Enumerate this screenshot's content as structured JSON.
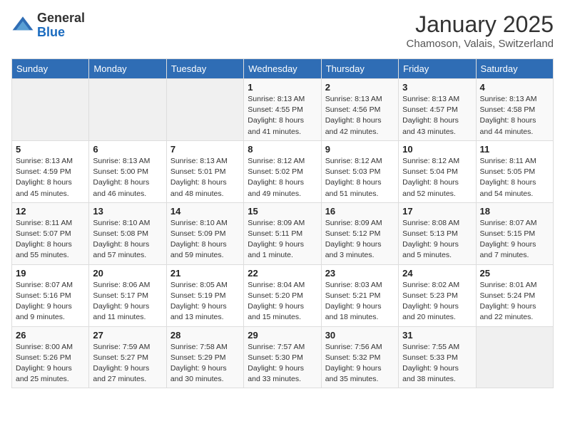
{
  "logo": {
    "general": "General",
    "blue": "Blue"
  },
  "calendar": {
    "title": "January 2025",
    "subtitle": "Chamoson, Valais, Switzerland"
  },
  "headers": [
    "Sunday",
    "Monday",
    "Tuesday",
    "Wednesday",
    "Thursday",
    "Friday",
    "Saturday"
  ],
  "weeks": [
    [
      {
        "day": "",
        "sunrise": "",
        "sunset": "",
        "daylight": ""
      },
      {
        "day": "",
        "sunrise": "",
        "sunset": "",
        "daylight": ""
      },
      {
        "day": "",
        "sunrise": "",
        "sunset": "",
        "daylight": ""
      },
      {
        "day": "1",
        "sunrise": "Sunrise: 8:13 AM",
        "sunset": "Sunset: 4:55 PM",
        "daylight": "Daylight: 8 hours and 41 minutes."
      },
      {
        "day": "2",
        "sunrise": "Sunrise: 8:13 AM",
        "sunset": "Sunset: 4:56 PM",
        "daylight": "Daylight: 8 hours and 42 minutes."
      },
      {
        "day": "3",
        "sunrise": "Sunrise: 8:13 AM",
        "sunset": "Sunset: 4:57 PM",
        "daylight": "Daylight: 8 hours and 43 minutes."
      },
      {
        "day": "4",
        "sunrise": "Sunrise: 8:13 AM",
        "sunset": "Sunset: 4:58 PM",
        "daylight": "Daylight: 8 hours and 44 minutes."
      }
    ],
    [
      {
        "day": "5",
        "sunrise": "Sunrise: 8:13 AM",
        "sunset": "Sunset: 4:59 PM",
        "daylight": "Daylight: 8 hours and 45 minutes."
      },
      {
        "day": "6",
        "sunrise": "Sunrise: 8:13 AM",
        "sunset": "Sunset: 5:00 PM",
        "daylight": "Daylight: 8 hours and 46 minutes."
      },
      {
        "day": "7",
        "sunrise": "Sunrise: 8:13 AM",
        "sunset": "Sunset: 5:01 PM",
        "daylight": "Daylight: 8 hours and 48 minutes."
      },
      {
        "day": "8",
        "sunrise": "Sunrise: 8:12 AM",
        "sunset": "Sunset: 5:02 PM",
        "daylight": "Daylight: 8 hours and 49 minutes."
      },
      {
        "day": "9",
        "sunrise": "Sunrise: 8:12 AM",
        "sunset": "Sunset: 5:03 PM",
        "daylight": "Daylight: 8 hours and 51 minutes."
      },
      {
        "day": "10",
        "sunrise": "Sunrise: 8:12 AM",
        "sunset": "Sunset: 5:04 PM",
        "daylight": "Daylight: 8 hours and 52 minutes."
      },
      {
        "day": "11",
        "sunrise": "Sunrise: 8:11 AM",
        "sunset": "Sunset: 5:05 PM",
        "daylight": "Daylight: 8 hours and 54 minutes."
      }
    ],
    [
      {
        "day": "12",
        "sunrise": "Sunrise: 8:11 AM",
        "sunset": "Sunset: 5:07 PM",
        "daylight": "Daylight: 8 hours and 55 minutes."
      },
      {
        "day": "13",
        "sunrise": "Sunrise: 8:10 AM",
        "sunset": "Sunset: 5:08 PM",
        "daylight": "Daylight: 8 hours and 57 minutes."
      },
      {
        "day": "14",
        "sunrise": "Sunrise: 8:10 AM",
        "sunset": "Sunset: 5:09 PM",
        "daylight": "Daylight: 8 hours and 59 minutes."
      },
      {
        "day": "15",
        "sunrise": "Sunrise: 8:09 AM",
        "sunset": "Sunset: 5:11 PM",
        "daylight": "Daylight: 9 hours and 1 minute."
      },
      {
        "day": "16",
        "sunrise": "Sunrise: 8:09 AM",
        "sunset": "Sunset: 5:12 PM",
        "daylight": "Daylight: 9 hours and 3 minutes."
      },
      {
        "day": "17",
        "sunrise": "Sunrise: 8:08 AM",
        "sunset": "Sunset: 5:13 PM",
        "daylight": "Daylight: 9 hours and 5 minutes."
      },
      {
        "day": "18",
        "sunrise": "Sunrise: 8:07 AM",
        "sunset": "Sunset: 5:15 PM",
        "daylight": "Daylight: 9 hours and 7 minutes."
      }
    ],
    [
      {
        "day": "19",
        "sunrise": "Sunrise: 8:07 AM",
        "sunset": "Sunset: 5:16 PM",
        "daylight": "Daylight: 9 hours and 9 minutes."
      },
      {
        "day": "20",
        "sunrise": "Sunrise: 8:06 AM",
        "sunset": "Sunset: 5:17 PM",
        "daylight": "Daylight: 9 hours and 11 minutes."
      },
      {
        "day": "21",
        "sunrise": "Sunrise: 8:05 AM",
        "sunset": "Sunset: 5:19 PM",
        "daylight": "Daylight: 9 hours and 13 minutes."
      },
      {
        "day": "22",
        "sunrise": "Sunrise: 8:04 AM",
        "sunset": "Sunset: 5:20 PM",
        "daylight": "Daylight: 9 hours and 15 minutes."
      },
      {
        "day": "23",
        "sunrise": "Sunrise: 8:03 AM",
        "sunset": "Sunset: 5:21 PM",
        "daylight": "Daylight: 9 hours and 18 minutes."
      },
      {
        "day": "24",
        "sunrise": "Sunrise: 8:02 AM",
        "sunset": "Sunset: 5:23 PM",
        "daylight": "Daylight: 9 hours and 20 minutes."
      },
      {
        "day": "25",
        "sunrise": "Sunrise: 8:01 AM",
        "sunset": "Sunset: 5:24 PM",
        "daylight": "Daylight: 9 hours and 22 minutes."
      }
    ],
    [
      {
        "day": "26",
        "sunrise": "Sunrise: 8:00 AM",
        "sunset": "Sunset: 5:26 PM",
        "daylight": "Daylight: 9 hours and 25 minutes."
      },
      {
        "day": "27",
        "sunrise": "Sunrise: 7:59 AM",
        "sunset": "Sunset: 5:27 PM",
        "daylight": "Daylight: 9 hours and 27 minutes."
      },
      {
        "day": "28",
        "sunrise": "Sunrise: 7:58 AM",
        "sunset": "Sunset: 5:29 PM",
        "daylight": "Daylight: 9 hours and 30 minutes."
      },
      {
        "day": "29",
        "sunrise": "Sunrise: 7:57 AM",
        "sunset": "Sunset: 5:30 PM",
        "daylight": "Daylight: 9 hours and 33 minutes."
      },
      {
        "day": "30",
        "sunrise": "Sunrise: 7:56 AM",
        "sunset": "Sunset: 5:32 PM",
        "daylight": "Daylight: 9 hours and 35 minutes."
      },
      {
        "day": "31",
        "sunrise": "Sunrise: 7:55 AM",
        "sunset": "Sunset: 5:33 PM",
        "daylight": "Daylight: 9 hours and 38 minutes."
      },
      {
        "day": "",
        "sunrise": "",
        "sunset": "",
        "daylight": ""
      }
    ]
  ]
}
